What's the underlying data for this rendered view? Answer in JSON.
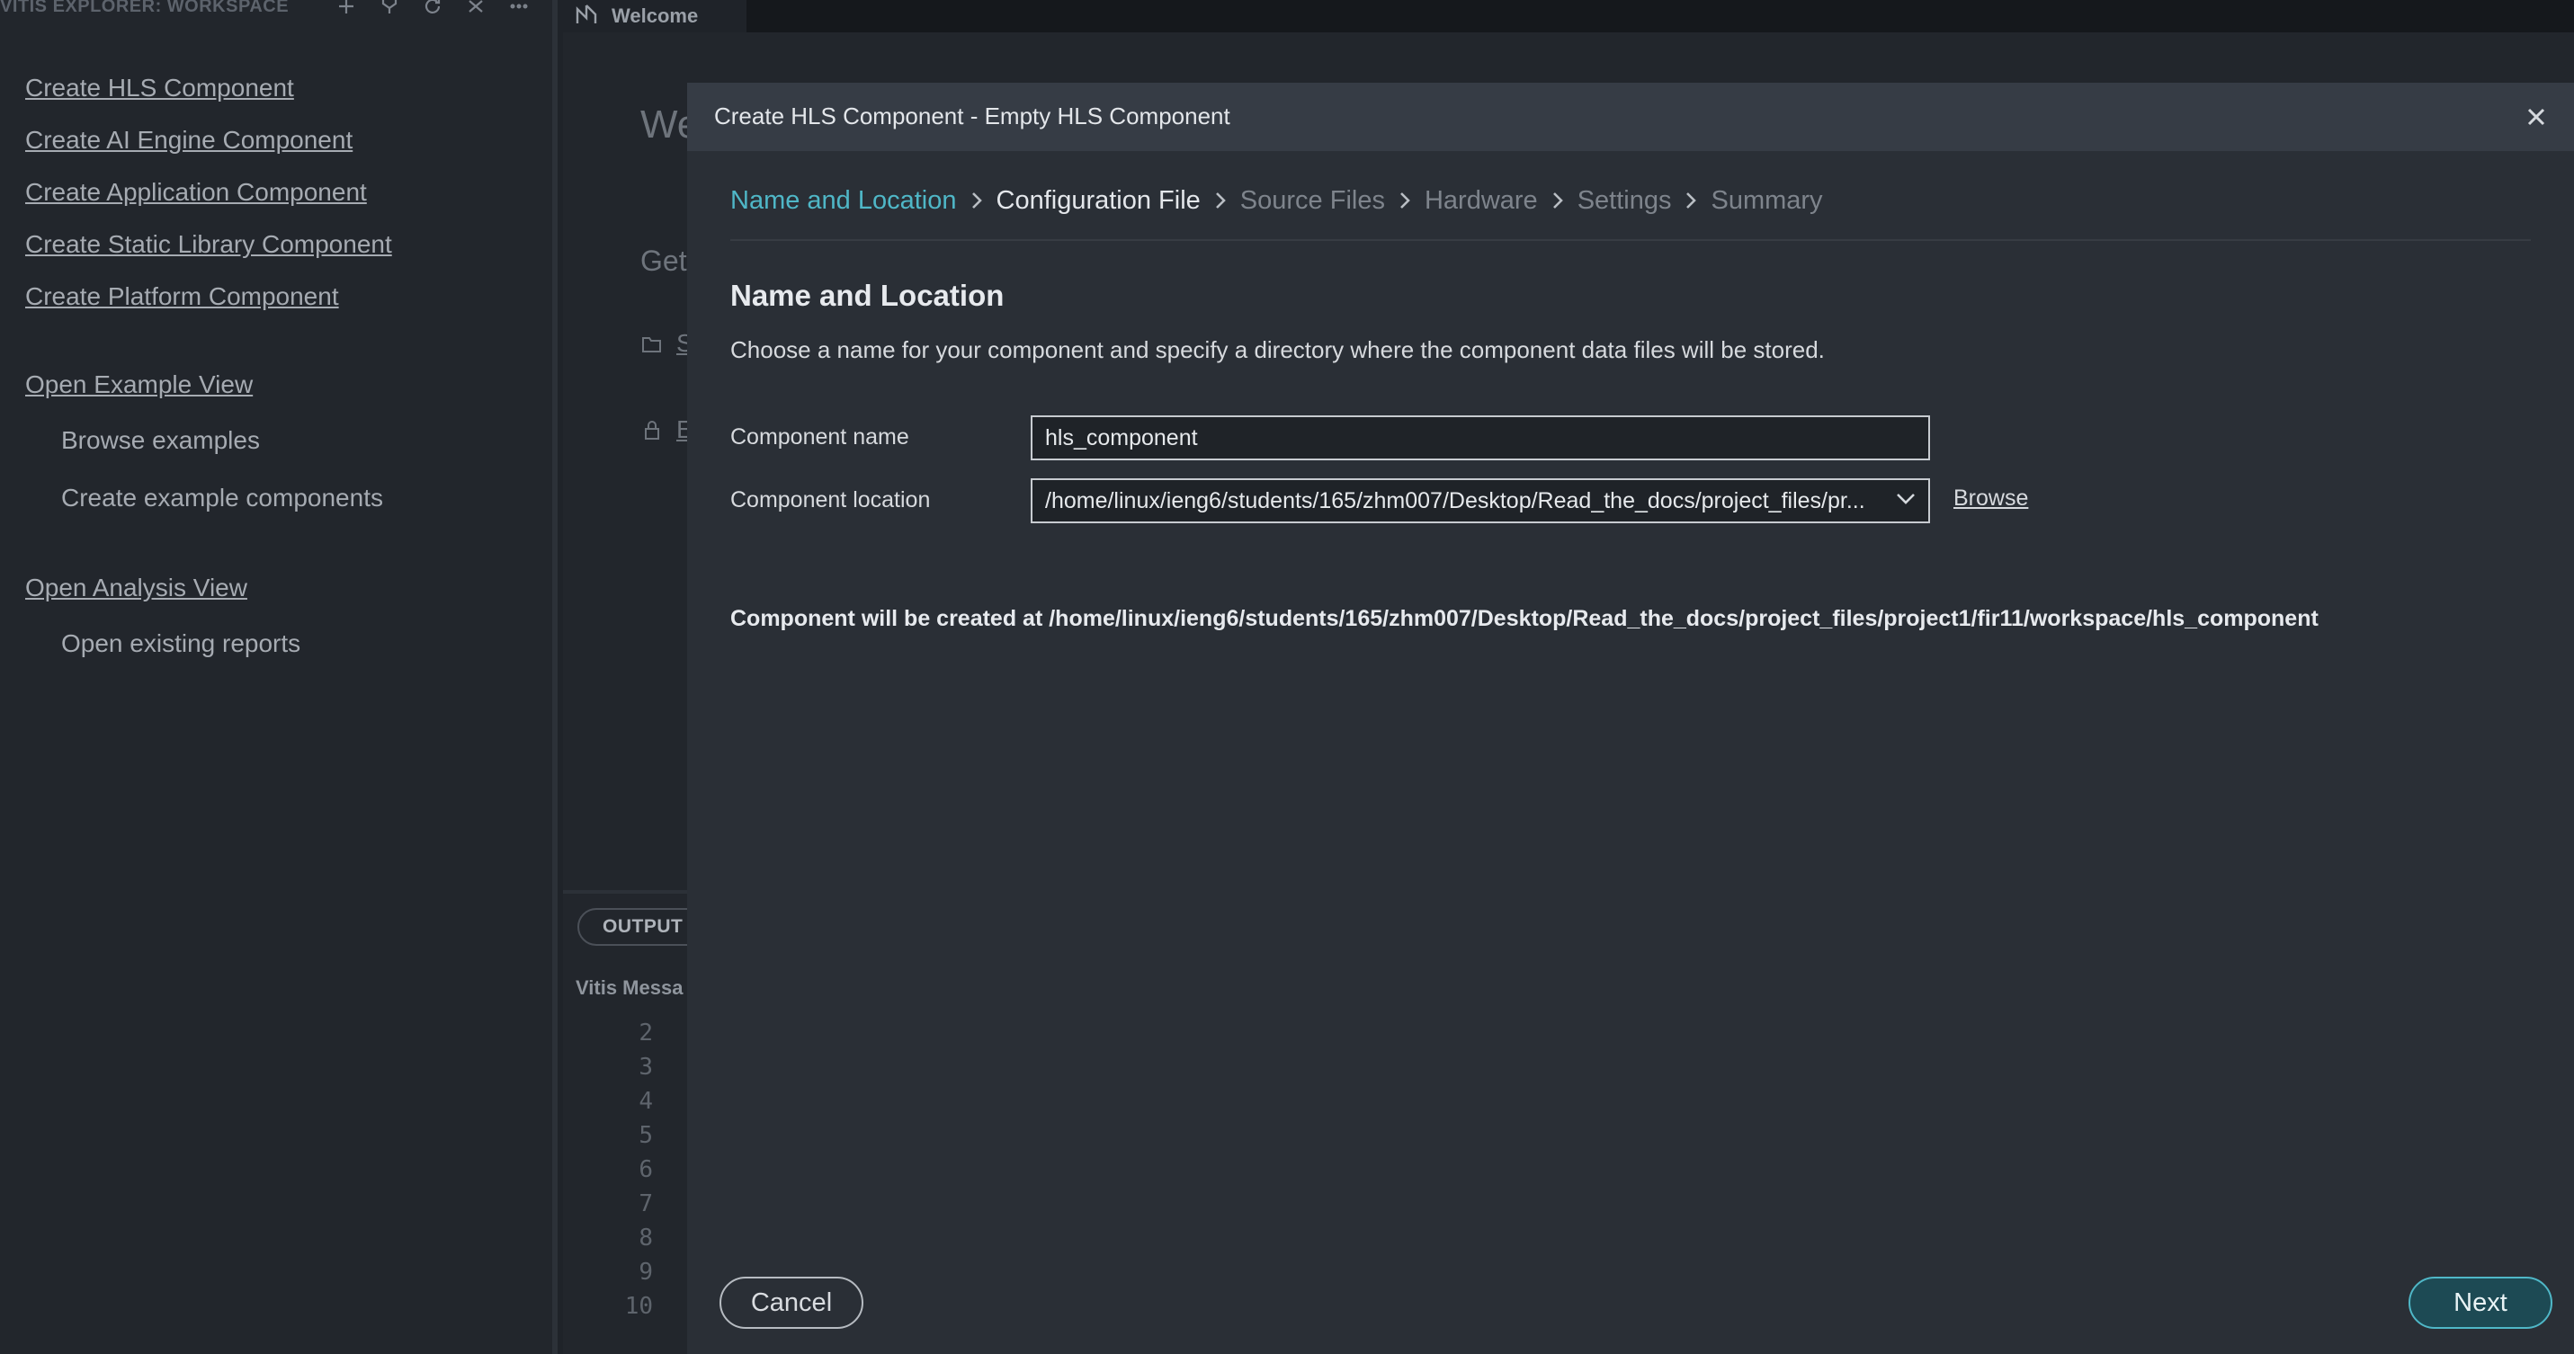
{
  "sidebar": {
    "title": "VITIS EXPLORER: WORKSPACE",
    "action_icons": [
      "plus-icon",
      "filter-icon",
      "refresh-icon",
      "collapse-icon",
      "more-icon"
    ],
    "links": {
      "create_hls": "Create HLS Component",
      "create_aie": "Create AI Engine Component",
      "create_app": "Create Application Component",
      "create_static_lib": "Create Static Library Component",
      "create_platform": "Create Platform Component",
      "open_example_view": "Open Example View",
      "browse_examples": "Browse examples",
      "create_example_components": "Create example components",
      "open_analysis_view": "Open Analysis View",
      "open_existing_reports": "Open existing reports"
    }
  },
  "editor": {
    "tab_label": "Welcome",
    "welcome_title_partial": "We",
    "get_started_partial": "Get",
    "icon_rows": [
      {
        "icon": "folder-open-icon",
        "text": "S"
      },
      {
        "icon": "lock-icon",
        "text": "E"
      }
    ]
  },
  "panel": {
    "tab_label": "OUTPUT",
    "channel_partial": "Vitis Messa",
    "line_numbers": [
      "2",
      "3",
      "4",
      "5",
      "6",
      "7",
      "8",
      "9",
      "10"
    ]
  },
  "dialog": {
    "title": "Create HLS Component - Empty HLS Component",
    "steps": [
      {
        "label": "Name and Location",
        "state": "active"
      },
      {
        "label": "Configuration File",
        "state": "current"
      },
      {
        "label": "Source Files",
        "state": "pending"
      },
      {
        "label": "Hardware",
        "state": "pending"
      },
      {
        "label": "Settings",
        "state": "pending"
      },
      {
        "label": "Summary",
        "state": "pending"
      }
    ],
    "section_title": "Name and Location",
    "description": "Choose a name for your component and specify a directory where the component data files will be stored.",
    "name_label": "Component name",
    "name_value": "hls_component",
    "location_label": "Component location",
    "location_value": "/home/linux/ieng6/students/165/zhm007/Desktop/Read_the_docs/project_files/pr...",
    "browse_label": "Browse",
    "created_at_text": "Component will be created at /home/linux/ieng6/students/165/zhm007/Desktop/Read_the_docs/project_files/project1/fir11/workspace/hls_component",
    "cancel_label": "Cancel",
    "next_label": "Next"
  },
  "colors": {
    "accent": "#4fb7c7",
    "dialog_bg": "#2a2f36",
    "titlebar_bg": "#363c45",
    "sidebar_bg": "#22262c"
  }
}
